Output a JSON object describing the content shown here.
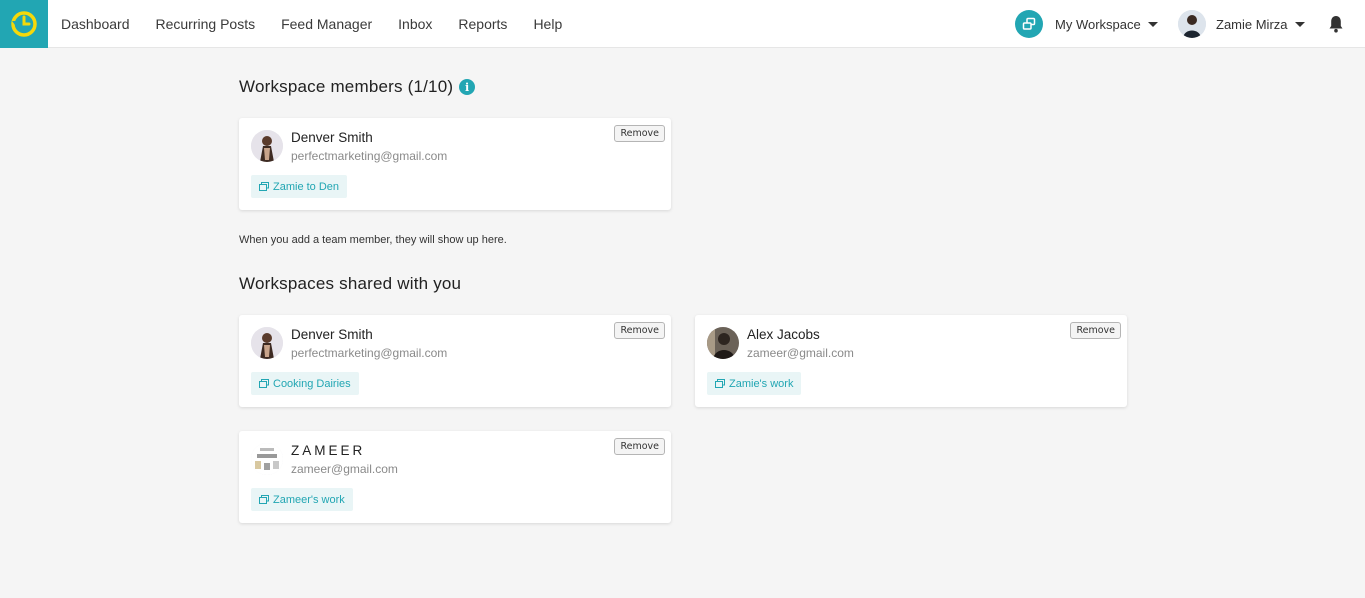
{
  "nav": {
    "items": [
      "Dashboard",
      "Recurring Posts",
      "Feed Manager",
      "Inbox",
      "Reports",
      "Help"
    ]
  },
  "header": {
    "workspace_label": "My Workspace",
    "user_name": "Zamie Mirza"
  },
  "colors": {
    "accent": "#22a6b3",
    "logo_mark": "#f5d90a"
  },
  "members_section": {
    "title": "Workspace members (1/10)",
    "hint": "When you add a team member, they will show up here."
  },
  "members": [
    {
      "name": "Denver Smith",
      "email": "perfectmarketing@gmail.com",
      "workspace": "Zamie to Den",
      "remove_label": "Remove"
    }
  ],
  "shared_section": {
    "title": "Workspaces shared with you"
  },
  "shared": [
    {
      "name": "Denver Smith",
      "email": "perfectmarketing@gmail.com",
      "workspace": "Cooking Dairies",
      "remove_label": "Remove"
    },
    {
      "name": "Alex Jacobs",
      "email": "zameer@gmail.com",
      "workspace": "Zamie's work",
      "remove_label": "Remove"
    },
    {
      "name": "ZAMEER",
      "email": "zameer@gmail.com",
      "workspace": "Zameer's work",
      "remove_label": "Remove"
    }
  ]
}
